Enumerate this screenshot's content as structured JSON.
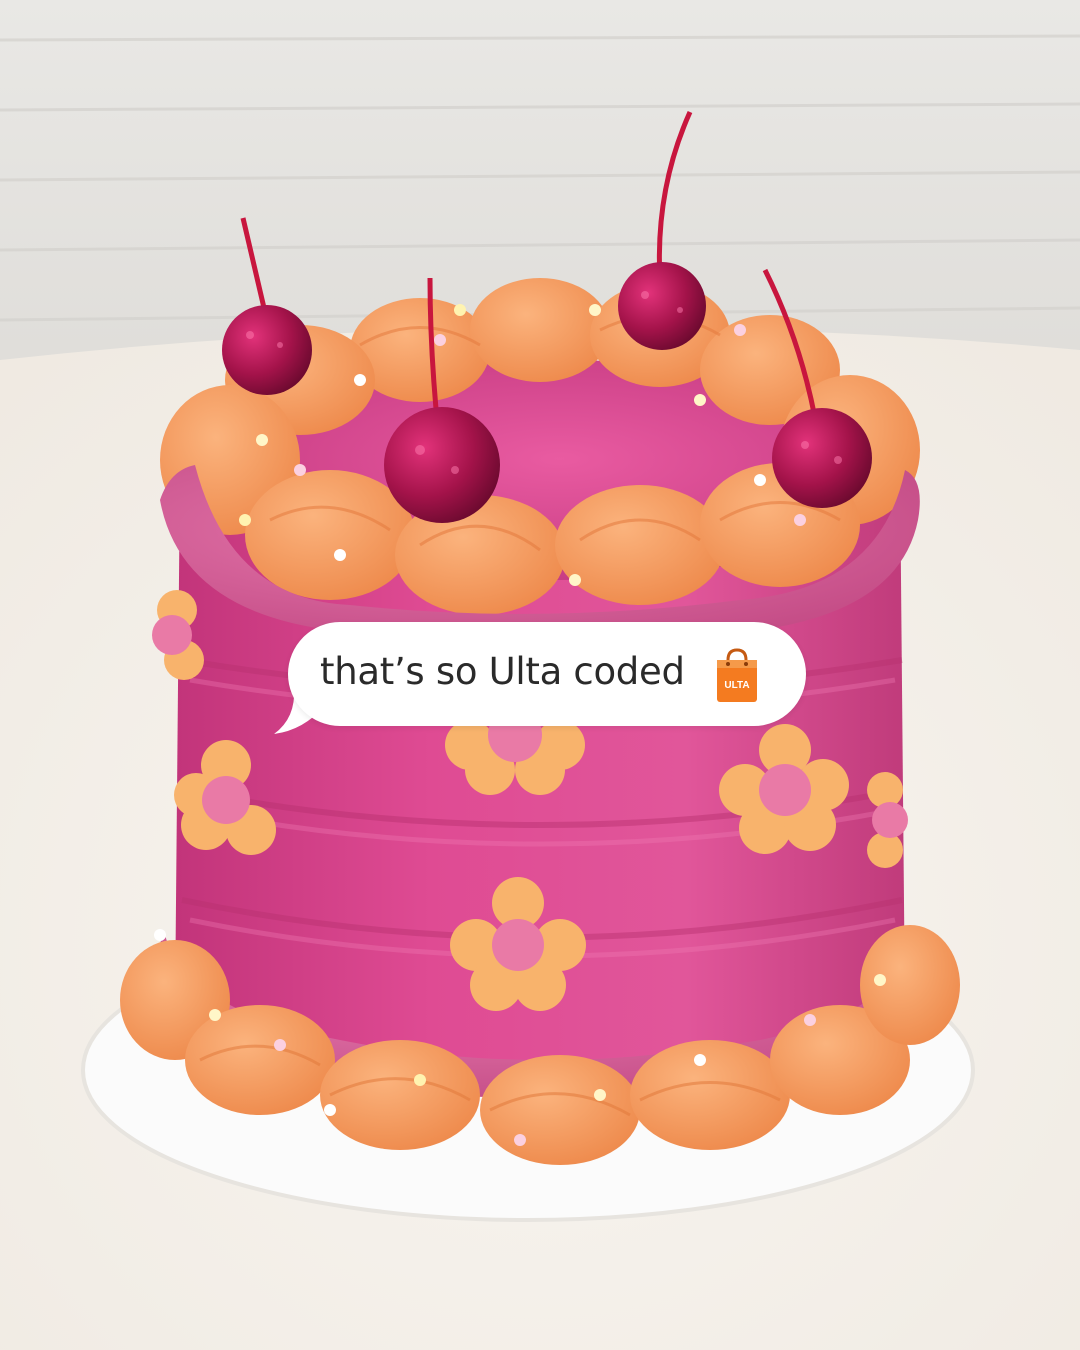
{
  "caption": {
    "text": "that’s so Ulta coded",
    "emoji": "shopping-bag-icon"
  },
  "brand_bag": {
    "label": "ULTA",
    "color": "#f47b20"
  },
  "scene": {
    "subject": "cake",
    "colors": {
      "wall": "#e7e6e3",
      "table": "#f4f0ea",
      "board": "#fbfbfb",
      "cake_pink": "#d6428a",
      "frosting_orange": "#f59a5e",
      "frosting_pink": "#d45a93",
      "cherry": "#9b1240",
      "flower": "#f8b36c",
      "flower_center": "#e97aa6"
    }
  }
}
